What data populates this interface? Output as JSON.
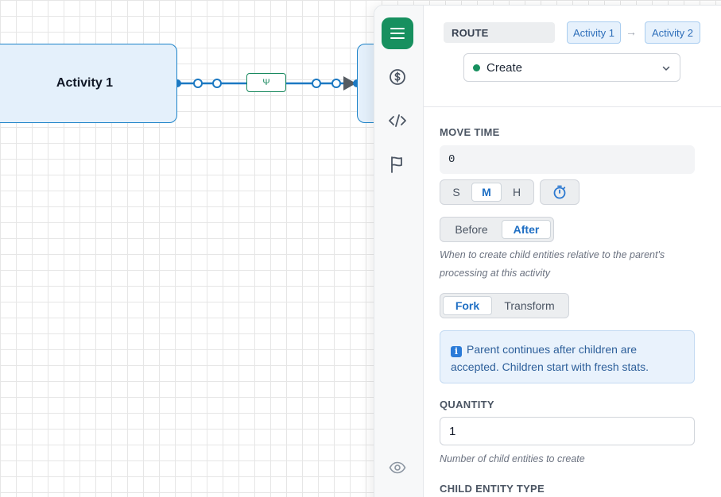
{
  "canvas": {
    "nodes": [
      {
        "label": "Activity 1"
      },
      {
        "label": ""
      }
    ],
    "edge_label": "Ψ"
  },
  "rail": {
    "icons": [
      "menu-icon",
      "dollar-icon",
      "code-icon",
      "flag-icon",
      "eye-icon"
    ],
    "active_color": "#17905f"
  },
  "header": {
    "route_label": "ROUTE",
    "from_activity": "Activity 1",
    "arrow": "→",
    "to_activity": "Activity 2",
    "mode_select": {
      "value": "Create",
      "status_color": "#17905f"
    }
  },
  "move_time": {
    "label": "MOVE TIME",
    "value": "0",
    "units": [
      {
        "label": "S",
        "selected": false
      },
      {
        "label": "M",
        "selected": true
      },
      {
        "label": "H",
        "selected": false
      }
    ],
    "timing": [
      {
        "label": "Before",
        "selected": false
      },
      {
        "label": "After",
        "selected": true
      }
    ],
    "timing_hint": "When to create child entities relative to the parent's processing at this activity"
  },
  "mode": {
    "options": [
      {
        "label": "Fork",
        "selected": true
      },
      {
        "label": "Transform",
        "selected": false
      }
    ],
    "info": "Parent continues after children are accepted. Children start with fresh stats."
  },
  "quantity": {
    "label": "QUANTITY",
    "value": "1",
    "hint": "Number of child entities to create"
  },
  "child_entity": {
    "label": "CHILD ENTITY TYPE"
  }
}
